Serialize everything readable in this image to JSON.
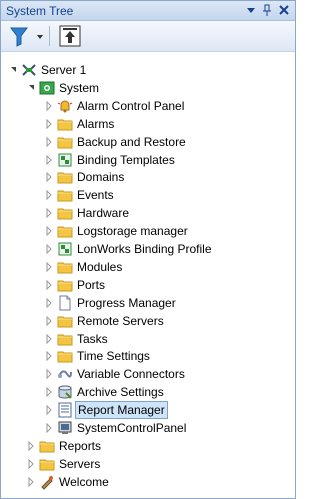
{
  "panel": {
    "title": "System Tree"
  },
  "tree": [
    {
      "label": "Server 1",
      "icon": "server-icon",
      "level": 0,
      "state": "expanded"
    },
    {
      "label": "System",
      "icon": "system-icon",
      "level": 1,
      "state": "expanded"
    },
    {
      "label": "Alarm Control Panel",
      "icon": "alarm-bell-icon",
      "level": 2,
      "state": "collapsed"
    },
    {
      "label": "Alarms",
      "icon": "folder-icon",
      "level": 2,
      "state": "collapsed"
    },
    {
      "label": "Backup and Restore",
      "icon": "folder-icon",
      "level": 2,
      "state": "collapsed"
    },
    {
      "label": "Binding Templates",
      "icon": "binding-icon",
      "level": 2,
      "state": "collapsed"
    },
    {
      "label": "Domains",
      "icon": "folder-icon",
      "level": 2,
      "state": "collapsed"
    },
    {
      "label": "Events",
      "icon": "folder-icon",
      "level": 2,
      "state": "collapsed"
    },
    {
      "label": "Hardware",
      "icon": "folder-icon",
      "level": 2,
      "state": "collapsed"
    },
    {
      "label": "Logstorage manager",
      "icon": "folder-icon",
      "level": 2,
      "state": "collapsed"
    },
    {
      "label": "LonWorks Binding Profile",
      "icon": "binding-icon",
      "level": 2,
      "state": "collapsed"
    },
    {
      "label": "Modules",
      "icon": "folder-icon",
      "level": 2,
      "state": "collapsed"
    },
    {
      "label": "Ports",
      "icon": "folder-icon",
      "level": 2,
      "state": "collapsed"
    },
    {
      "label": "Progress Manager",
      "icon": "document-icon",
      "level": 2,
      "state": "collapsed"
    },
    {
      "label": "Remote Servers",
      "icon": "folder-icon",
      "level": 2,
      "state": "collapsed"
    },
    {
      "label": "Tasks",
      "icon": "folder-icon",
      "level": 2,
      "state": "collapsed"
    },
    {
      "label": "Time Settings",
      "icon": "folder-icon",
      "level": 2,
      "state": "collapsed"
    },
    {
      "label": "Variable Connectors",
      "icon": "connector-icon",
      "level": 2,
      "state": "collapsed"
    },
    {
      "label": "Archive Settings",
      "icon": "archive-icon",
      "level": 2,
      "state": "collapsed"
    },
    {
      "label": "Report Manager",
      "icon": "report-icon",
      "level": 2,
      "state": "collapsed",
      "selected": true
    },
    {
      "label": "SystemControlPanel",
      "icon": "control-panel-icon",
      "level": 2,
      "state": "collapsed"
    },
    {
      "label": "Reports",
      "icon": "folder-icon",
      "level": 1,
      "state": "collapsed"
    },
    {
      "label": "Servers",
      "icon": "folder-icon",
      "level": 1,
      "state": "collapsed"
    },
    {
      "label": "Welcome",
      "icon": "welcome-icon",
      "level": 1,
      "state": "collapsed"
    }
  ],
  "colors": {
    "selection": "#cde4f9",
    "selection_border": "#7da2ce",
    "title_text": "#15428b"
  }
}
